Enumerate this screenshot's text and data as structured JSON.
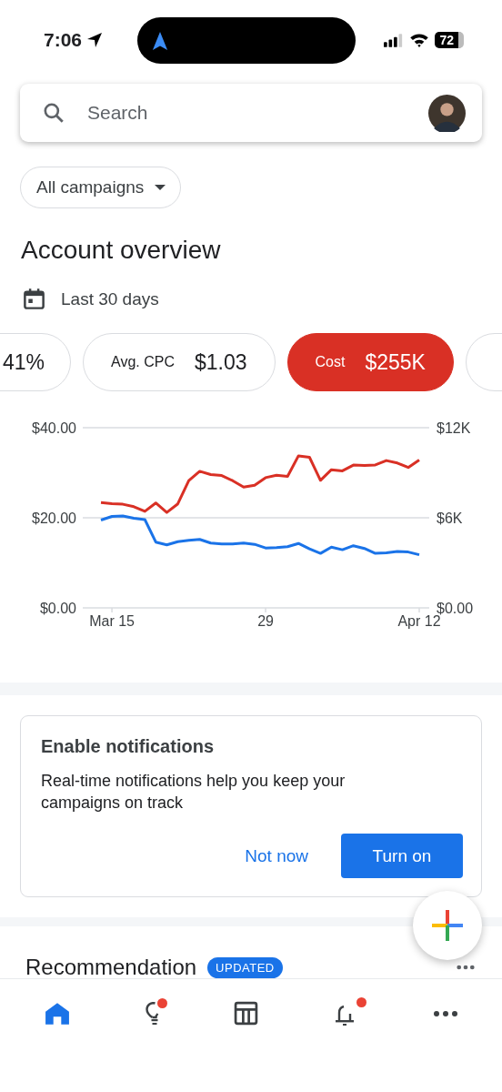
{
  "status_bar": {
    "time": "7:06",
    "battery": "72"
  },
  "search": {
    "placeholder": "Search"
  },
  "campaign_filter": {
    "label": "All campaigns"
  },
  "title": "Account overview",
  "date_range": {
    "label": "Last 30 days"
  },
  "metrics": [
    {
      "value": "41%",
      "selected": false
    },
    {
      "label": "Avg. CPC",
      "value": "$1.03",
      "selected": false
    },
    {
      "label": "Cost",
      "value": "$255K",
      "selected": true
    },
    {
      "selected": false
    }
  ],
  "chart_data": {
    "type": "line",
    "categories": [
      null,
      "Mar 15",
      null,
      null,
      null,
      null,
      null,
      null,
      null,
      null,
      null,
      null,
      null,
      null,
      null,
      "29",
      null,
      null,
      null,
      null,
      null,
      null,
      null,
      null,
      null,
      null,
      null,
      null,
      null,
      "Apr 12"
    ],
    "ylim": [
      0,
      40
    ],
    "yticks": [
      {
        "value": 0,
        "label": "$0.00"
      },
      {
        "value": 20,
        "label": "$20.00"
      },
      {
        "value": 40,
        "label": "$40.00"
      }
    ],
    "y2lim": [
      0,
      12
    ],
    "y2ticks": [
      {
        "value": 0,
        "label": "$0.00"
      },
      {
        "value": 6,
        "label": "$6K"
      },
      {
        "value": 12,
        "label": "$12K"
      }
    ],
    "series": [
      {
        "color": "#d93025",
        "axis": "y2",
        "values": [
          7.01,
          6.94,
          6.9,
          6.74,
          6.43,
          6.99,
          6.36,
          6.93,
          8.47,
          9.1,
          8.88,
          8.81,
          8.47,
          8.05,
          8.17,
          8.67,
          8.83,
          8.76,
          10.13,
          10.03,
          8.5,
          9.2,
          9.13,
          9.51,
          9.49,
          9.52,
          9.81,
          9.65,
          9.35,
          9.85
        ]
      },
      {
        "color": "#1a73e8",
        "values": [
          19.5,
          20.3,
          20.4,
          19.9,
          19.6,
          14.6,
          14.0,
          14.7,
          15.0,
          15.2,
          14.4,
          14.2,
          14.2,
          14.4,
          14.1,
          13.3,
          13.4,
          13.6,
          14.3,
          13.1,
          12.1,
          13.5,
          12.9,
          13.8,
          13.2,
          12.1,
          12.2,
          12.5,
          12.4,
          11.8
        ]
      }
    ]
  },
  "notification_card": {
    "title": "Enable notifications",
    "text": "Real-time notifications help you keep your campaigns on track",
    "buttons": [
      {
        "label": "Not now",
        "kind": "text"
      },
      {
        "label": "Turn on",
        "kind": "filled"
      }
    ]
  },
  "recommendation": {
    "title": "Recommendation",
    "badge": "UPDATED"
  },
  "bottom_nav": [
    {
      "kind": "home",
      "selected": true,
      "badge": false
    },
    {
      "kind": "ideas",
      "selected": false,
      "badge": true
    },
    {
      "kind": "table",
      "selected": false,
      "badge": false
    },
    {
      "kind": "alerts",
      "selected": false,
      "badge": true
    },
    {
      "kind": "more",
      "selected": false,
      "badge": false
    }
  ]
}
